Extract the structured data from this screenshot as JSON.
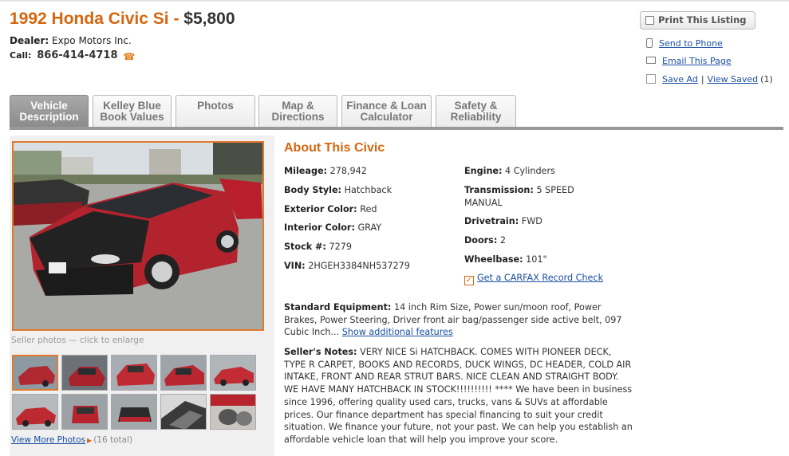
{
  "header": {
    "car_name": "1992 Honda Civic Si",
    "separator": "-",
    "price": "$5,800",
    "dealer_label": "Dealer:",
    "dealer_name": "Expo Motors Inc.",
    "call_label": "Call:",
    "phone": "866-414-4718"
  },
  "actions": {
    "print_label": "Print This Listing",
    "send_to_phone": "Send to Phone",
    "email_page": "Email This Page",
    "save_ad": "Save Ad",
    "separator": "|",
    "view_saved": "View Saved",
    "saved_count": "(1)"
  },
  "tabs": [
    {
      "line1": "Vehicle",
      "line2": "Description"
    },
    {
      "line1": "Kelley Blue",
      "line2": "Book Values"
    },
    {
      "line1": "Photos",
      "line2": ""
    },
    {
      "line1": "Map &",
      "line2": "Directions"
    },
    {
      "line1": "Finance & Loan",
      "line2": "Calculator"
    },
    {
      "line1": "Safety &",
      "line2": "Reliability"
    }
  ],
  "gallery": {
    "caption": "Seller photos — click to enlarge",
    "more_link": "View More Photos",
    "total": "(16 total)"
  },
  "about": {
    "title": "About This Civic",
    "specs": {
      "mileage_label": "Mileage:",
      "mileage": "278,942",
      "body_label": "Body Style:",
      "body": "Hatchback",
      "ext_label": "Exterior Color:",
      "ext": "Red",
      "int_label": "Interior Color:",
      "int": "GRAY",
      "stock_label": "Stock #:",
      "stock": "7279",
      "vin_label": "VIN:",
      "vin": "2HGEH3384NH537279",
      "engine_label": "Engine:",
      "engine": "4 Cylinders",
      "trans_label": "Transmission:",
      "trans_line1": "5 SPEED",
      "trans_line2": "MANUAL",
      "drive_label": "Drivetrain:",
      "drive": "FWD",
      "doors_label": "Doors:",
      "doors": "2",
      "wheelbase_label": "Wheelbase:",
      "wheelbase": "101\""
    },
    "carfax": "Get a CARFAX Record Check",
    "equipment_label": "Standard Equipment:",
    "equipment_lines": [
      "14 inch Rim Size, Power sun/moon roof, Power",
      "Brakes, Power Steering, Driver front air bag/passenger side active belt, 097",
      "Cubic Inch..."
    ],
    "show_features": "Show additional features",
    "notes_label": "Seller's Notes:",
    "notes_lines": [
      "VERY NICE Si HATCHBACK. COMES WITH PIONEER DECK,",
      "TYPE R CARPET, BOOKS AND RECORDS, DUCK WINGS, DC HEADER, COLD AIR",
      "INTAKE, FRONT AND REAR STRUT BARS. NICE CLEAN AND STRAIGHT BODY.",
      "WE HAVE MANY HATCHBACK IN STOCK!!!!!!!!!! **** We have been in business",
      "since 1996, offering quality used cars, trucks, vans & SUVs at affordable",
      "prices. Our finance department has special financing to suit your credit",
      "situation. We finance your future, not your past. We can help you establish an",
      "affordable vehicle loan that will help you improve your score."
    ]
  },
  "colors": {
    "accent": "#d4660f",
    "link": "#1a4fa3",
    "tab_active": "#999999"
  }
}
